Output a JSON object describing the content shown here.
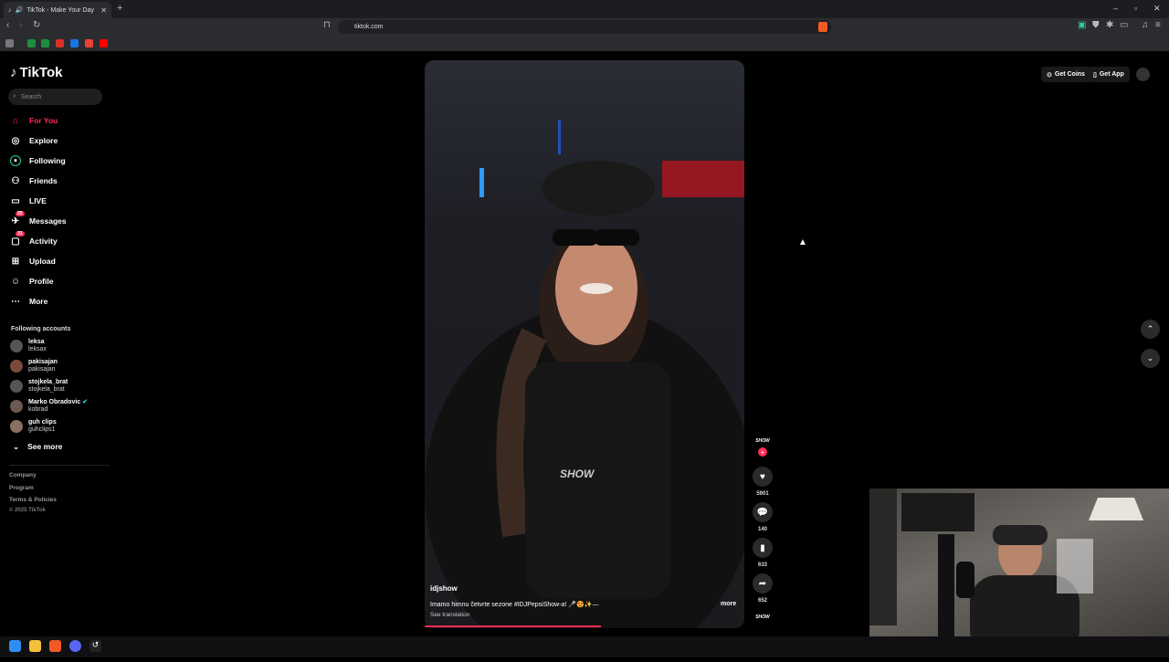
{
  "browser": {
    "tab_title": "TikTok - Make Your Day",
    "url": "tiktok.com"
  },
  "sidebar": {
    "logo": "TikTok",
    "search_placeholder": "Search",
    "nav": [
      {
        "label": "For You",
        "icon": "home-icon",
        "active": true
      },
      {
        "label": "Explore",
        "icon": "compass-icon"
      },
      {
        "label": "Following",
        "icon": "following-icon"
      },
      {
        "label": "Friends",
        "icon": "friends-icon"
      },
      {
        "label": "LIVE",
        "icon": "live-icon"
      },
      {
        "label": "Messages",
        "icon": "messages-icon",
        "badge": "25"
      },
      {
        "label": "Activity",
        "icon": "activity-icon",
        "badge": "31"
      },
      {
        "label": "Upload",
        "icon": "upload-icon"
      },
      {
        "label": "Profile",
        "icon": "profile-icon"
      },
      {
        "label": "More",
        "icon": "more-icon"
      }
    ],
    "following_title": "Following accounts",
    "accounts": [
      {
        "name": "leksa",
        "handle": "leksax"
      },
      {
        "name": "pakisajan",
        "handle": "pakisajan"
      },
      {
        "name": "stojkela_brat",
        "handle": "stojkela_brat"
      },
      {
        "name": "Marko Obradovic",
        "handle": "kobrad"
      },
      {
        "name": "guh clips",
        "handle": "guhclips1"
      }
    ],
    "see_more": "See more",
    "footer": [
      "Company",
      "Program",
      "Terms & Policies",
      "© 2025 TikTok"
    ]
  },
  "video": {
    "author": "idjshow",
    "caption": "Imamo himnu četvrte sezone #IDJPepsiShow-a! 🎤😍✨—",
    "more": "more",
    "see_translation": "See translation",
    "watermark": "SHOW",
    "progress": 0.55
  },
  "actions": {
    "avatar_label": "SHOW",
    "likes": "5901",
    "comments": "140",
    "saves": "633",
    "shares": "652",
    "next_avatar_label": "SHOW"
  },
  "topright": {
    "get_coins": "Get Coins",
    "get_app": "Get App"
  },
  "colors": {
    "accent": "#fe2c55",
    "bg": "#000000"
  }
}
